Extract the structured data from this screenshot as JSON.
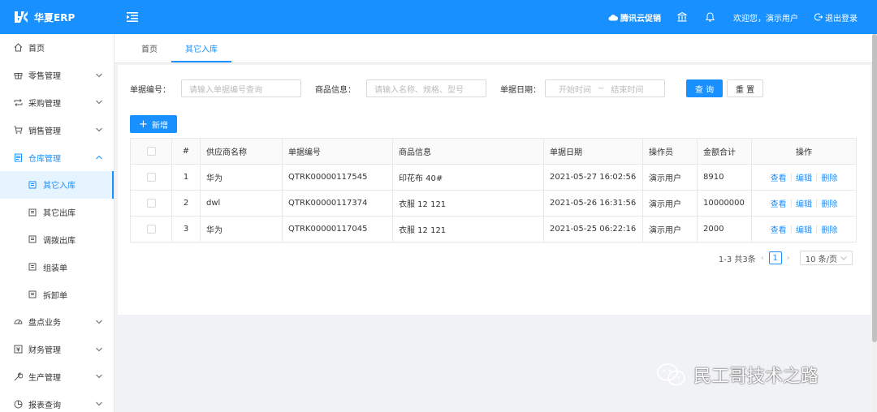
{
  "app": {
    "title": "华夏ERP"
  },
  "header": {
    "promo": "腾讯云促销",
    "welcome": "欢迎您，演示用户",
    "logout": "退出登录"
  },
  "sidebar": {
    "items": [
      {
        "label": "首页",
        "icon": "home-icon",
        "type": "top"
      },
      {
        "label": "零售管理",
        "icon": "gift-icon",
        "type": "group"
      },
      {
        "label": "采购管理",
        "icon": "retweet-icon",
        "type": "group"
      },
      {
        "label": "销售管理",
        "icon": "cart-icon",
        "type": "group"
      },
      {
        "label": "仓库管理",
        "icon": "warehouse-icon",
        "type": "group-open"
      },
      {
        "label": "其它入库",
        "icon": "doc-icon",
        "type": "sub-selected"
      },
      {
        "label": "其它出库",
        "icon": "doc-icon",
        "type": "sub"
      },
      {
        "label": "调拨出库",
        "icon": "doc-icon",
        "type": "sub"
      },
      {
        "label": "组装单",
        "icon": "doc-icon",
        "type": "sub"
      },
      {
        "label": "拆卸单",
        "icon": "doc-icon",
        "type": "sub"
      },
      {
        "label": "盘点业务",
        "icon": "dashboard-icon",
        "type": "group"
      },
      {
        "label": "财务管理",
        "icon": "finance-icon",
        "type": "group"
      },
      {
        "label": "生产管理",
        "icon": "tool-icon",
        "type": "group"
      },
      {
        "label": "报表查询",
        "icon": "chart-icon",
        "type": "group"
      }
    ]
  },
  "tabs": [
    {
      "label": "首页"
    },
    {
      "label": "其它入库"
    }
  ],
  "search": {
    "bill_no_label": "单据编号：",
    "bill_no_placeholder": "请输入单据编号查询",
    "goods_label": "商品信息：",
    "goods_placeholder": "请输入名称、规格、型号",
    "date_label": "单据日期：",
    "date_start": "开始时间",
    "date_sep": "~",
    "date_end": "结束时间",
    "query_label": "查 询",
    "reset_label": "重 置"
  },
  "toolbar": {
    "add_label": "新增"
  },
  "table": {
    "headers": [
      "#",
      "供应商名称",
      "单据编号",
      "商品信息",
      "单据日期",
      "操作员",
      "金额合计",
      "操作"
    ],
    "rows": [
      {
        "index": "1",
        "supplier": "华为",
        "bill_no": "QTRK00000117545",
        "goods": "印花布 40#",
        "date": "2021-05-27 16:02:56",
        "operator": "演示用户",
        "amount": "8910"
      },
      {
        "index": "2",
        "supplier": "dwl",
        "bill_no": "QTRK00000117374",
        "goods": "衣服 12 121",
        "date": "2021-05-26 16:31:56",
        "operator": "演示用户",
        "amount": "10000000"
      },
      {
        "index": "3",
        "supplier": "华为",
        "bill_no": "QTRK00000117045",
        "goods": "衣服 12 121",
        "date": "2021-05-25 06:22:16",
        "operator": "演示用户",
        "amount": "2000"
      }
    ],
    "actions": {
      "view": "查看",
      "edit": "编辑",
      "delete": "删除"
    }
  },
  "pagination": {
    "total_text": "1-3 共3条",
    "current_page": "1",
    "page_size": "10 条/页"
  },
  "watermark": {
    "text": "民工哥技术之路"
  },
  "colors": {
    "primary": "#1890ff",
    "header_bg": "#1890ff"
  }
}
